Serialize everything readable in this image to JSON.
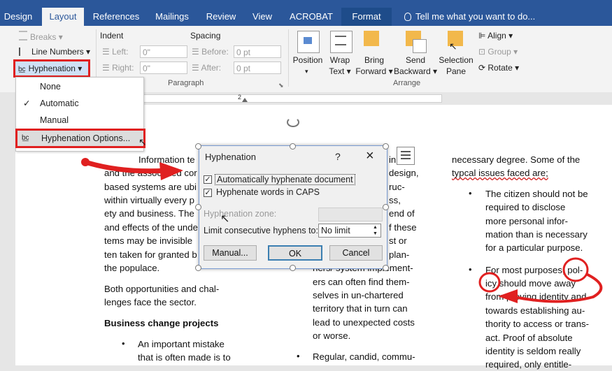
{
  "tabs": [
    {
      "label": "Design"
    },
    {
      "label": "Layout"
    },
    {
      "label": "References"
    },
    {
      "label": "Mailings"
    },
    {
      "label": "Review"
    },
    {
      "label": "View"
    },
    {
      "label": "ACROBAT"
    },
    {
      "label": "Format"
    }
  ],
  "tell_me": "Tell me what you want to do...",
  "page_setup": {
    "breaks": "Breaks",
    "line_numbers": "Line Numbers",
    "hyphenation": "Hyphenation"
  },
  "paragraph": {
    "group_label": "Paragraph",
    "indent_label": "Indent",
    "spacing_label": "Spacing",
    "left_label": "Left:",
    "right_label": "Right:",
    "before_label": "Before:",
    "after_label": "After:",
    "left_value": "0\"",
    "right_value": "0\"",
    "before_value": "0 pt",
    "after_value": "0 pt"
  },
  "arrange": {
    "group_label": "Arrange",
    "position": "Position",
    "wrap": "Wrap",
    "wrap2": "Text",
    "bring": "Bring",
    "bring2": "Forward",
    "send": "Send",
    "send2": "Backward",
    "selection": "Selection",
    "selection2": "Pane",
    "align": "Align",
    "group": "Group",
    "rotate": "Rotate"
  },
  "hyphen_menu": {
    "none": "None",
    "automatic": "Automatic",
    "manual": "Manual",
    "options": "Hyphenation Options..."
  },
  "dialog": {
    "title": "Hyphenation",
    "help": "?",
    "close": "×",
    "auto_label": "Automatically hyphenate document",
    "auto_checked": true,
    "caps_label": "Hyphenate words in CAPS",
    "caps_checked": true,
    "zone_label": "Hyphenation zone:",
    "limit_label": "Limit consecutive hyphens to:",
    "limit_value": "No limit",
    "manual_btn": "Manual...",
    "ok_btn": "OK",
    "cancel_btn": "Cancel"
  },
  "doc": {
    "col1_lines": [
      "Information te",
      "and the associated cor",
      "based systems are ubi",
      "within virtually every p",
      "ety and business.  The",
      "and effects of the unde",
      "tems may be invisible",
      "ten taken for granted b",
      "the populace."
    ],
    "col1_para2": [
      "Both opportunities and chal-",
      "lenges face the sector."
    ],
    "col1_heading": "Business change projects",
    "col1_bullet": [
      "An important mistake",
      "that is often made is to"
    ],
    "col2_right": [
      "in",
      "design,",
      "ruc-",
      "ss,",
      "end of",
      "f these",
      "st or",
      "plan-"
    ],
    "col2_lines": [
      "ners/ system implement-",
      "ers can often find them-",
      "selves in un-chartered",
      "territory that in turn can",
      "lead to unexpected costs",
      "or worse."
    ],
    "col2_bullet": "Regular, candid, commu-",
    "col3_intro": [
      "necessary degree.  Some of the",
      "typcal issues faced are;"
    ],
    "col3_b1": [
      "The citizen should not be",
      "required to disclose",
      "more personal infor-",
      "mation than is necessary",
      "for a particular purpose."
    ],
    "col3_b2": [
      "For most purposes, pol-",
      "icy should move away",
      "from proving identity and",
      "towards establishing au-",
      "thority to access or trans-",
      "act.  Proof of absolute",
      "identity is seldom really",
      "required, only entitle-"
    ]
  }
}
